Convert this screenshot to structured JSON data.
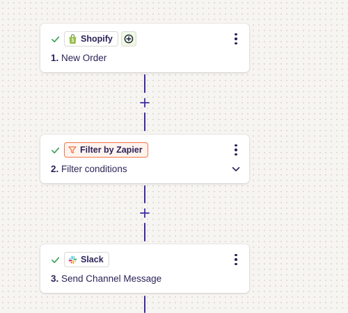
{
  "steps": [
    {
      "number": "1.",
      "title": "New Order",
      "app": "Shopify",
      "app_icon": "shopify-bag-icon",
      "status_icon": "check-icon",
      "extra_badge_icon": "circle-plus-icon",
      "menu_icon": "kebab-menu-icon"
    },
    {
      "number": "2.",
      "title": "Filter conditions",
      "app": "Filter by Zapier",
      "app_icon": "filter-funnel-icon",
      "status_icon": "check-icon",
      "menu_icon": "kebab-menu-icon",
      "expand_icon": "chevron-down-icon"
    },
    {
      "number": "3.",
      "title": "Send Channel Message",
      "app": "Slack",
      "app_icon": "slack-logo-icon",
      "status_icon": "check-icon",
      "menu_icon": "kebab-menu-icon"
    }
  ],
  "connectors": [
    {
      "add_icon": "plus-icon"
    },
    {
      "add_icon": "plus-icon"
    }
  ],
  "colors": {
    "canvas_background": "#f7f5f2",
    "connector": "#3b2aa8",
    "check": "#2e9b4a",
    "filter_accent": "#f07747",
    "text_primary": "#2b2358",
    "shopify_green": "#95bf47"
  }
}
